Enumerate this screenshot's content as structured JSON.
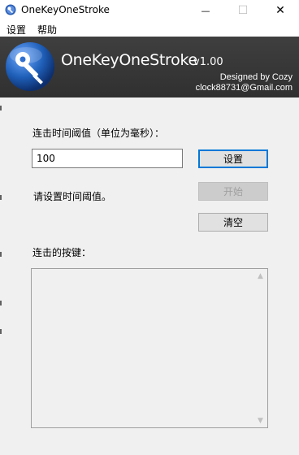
{
  "window": {
    "title": "OneKeyOneStroke",
    "minimize_glyph": "—",
    "maximize_glyph": "☐",
    "close_glyph": "✕"
  },
  "menu": {
    "items": [
      "设置",
      "帮助"
    ]
  },
  "banner": {
    "app_name": "OneKeyOneStroke",
    "version": "v1.00",
    "designed_by": "Designed by Cozy",
    "email": "clock88731@Gmail.com",
    "logo_icon": "key-icon",
    "bg_color": "#333333",
    "logo_color": "#1f5fb8"
  },
  "form": {
    "threshold_label": "连击时间阈值（单位为毫秒）：",
    "threshold_value": "100",
    "status_text": "请设置时间阈值。",
    "keys_label": "连击的按键："
  },
  "buttons": {
    "set": "设置",
    "start": "开始",
    "clear": "清空"
  },
  "colors": {
    "accent": "#0078d7",
    "disabled_text": "#a0a0a0"
  }
}
